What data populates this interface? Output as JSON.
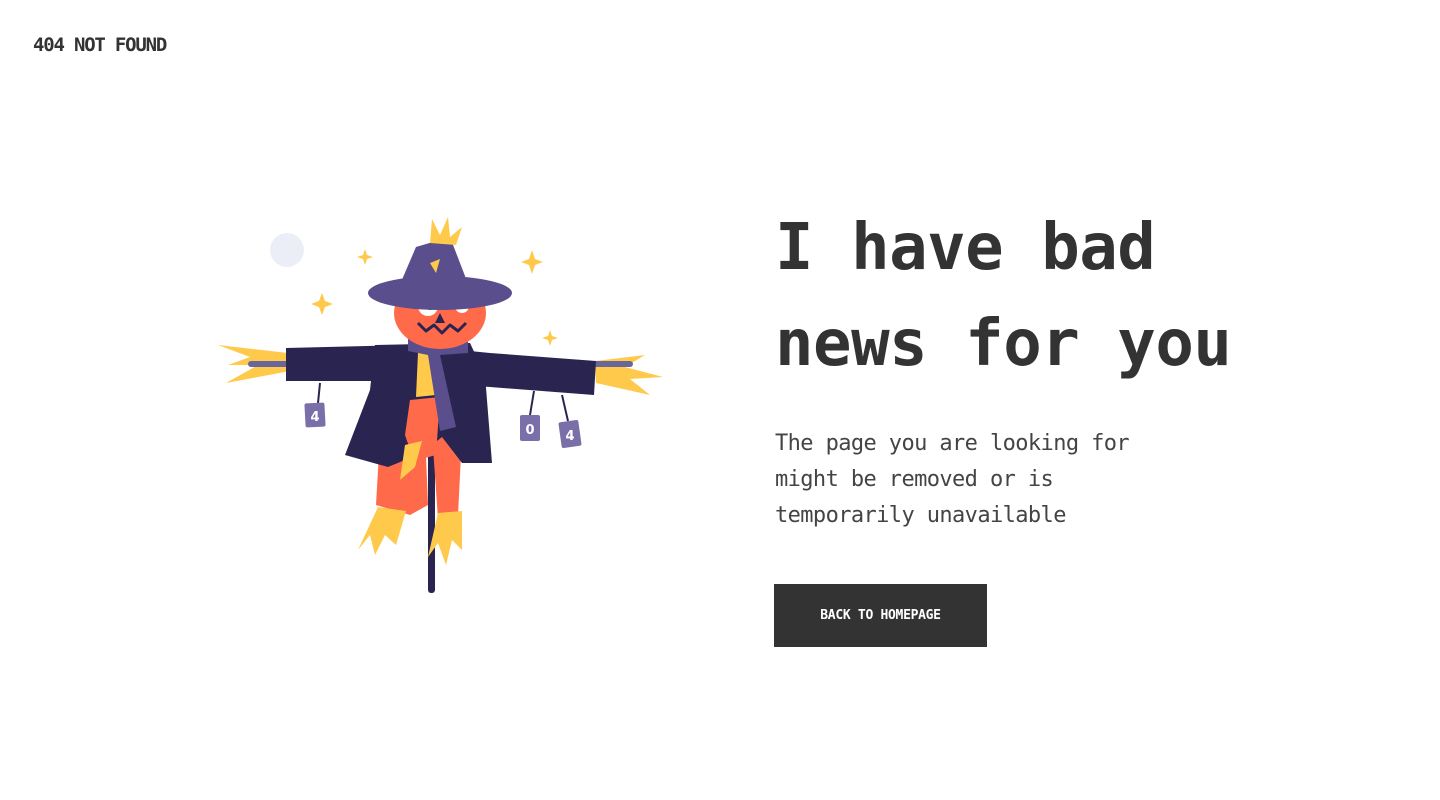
{
  "header": {
    "brand": "404 NOT FOUND"
  },
  "illustration": {
    "name": "scarecrow",
    "can_labels": [
      "4",
      "0",
      "4"
    ],
    "colors": {
      "hat": "#5a4e8c",
      "coat": "#2a2550",
      "face": "#ff6b4a",
      "straw": "#ffca4b",
      "scarf": "#5a4e8c",
      "moon": "#eceef7",
      "pole": "#2a2550"
    }
  },
  "main": {
    "headline": "I have bad news for you",
    "description": "The page you are looking for might be removed or is temporarily unavailable",
    "button_label": "BACK TO HOMEPAGE"
  },
  "colors": {
    "text": "#333333",
    "button_bg": "#333333",
    "button_text": "#ffffff",
    "background": "#ffffff"
  }
}
